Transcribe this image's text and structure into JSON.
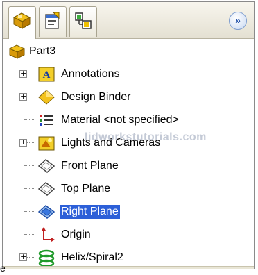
{
  "panel": {
    "tabs": [
      {
        "name": "feature-manager",
        "icon": "part-icon"
      },
      {
        "name": "property-manager",
        "icon": "property-icon"
      },
      {
        "name": "configuration-manager",
        "icon": "configuration-icon"
      }
    ],
    "expand_label": "»"
  },
  "tree": {
    "root": {
      "label": "Part3",
      "icon": "part-icon"
    },
    "items": [
      {
        "label": "Annotations",
        "icon": "annotations-icon",
        "expandable": true
      },
      {
        "label": "Design Binder",
        "icon": "design-binder-icon",
        "expandable": true
      },
      {
        "label": "Material <not specified>",
        "icon": "material-icon",
        "expandable": false
      },
      {
        "label": "Lights and Cameras",
        "icon": "lights-cameras-icon",
        "expandable": true
      },
      {
        "label": "Front Plane",
        "icon": "plane-icon",
        "expandable": false
      },
      {
        "label": "Top Plane",
        "icon": "plane-icon",
        "expandable": false
      },
      {
        "label": "Right Plane",
        "icon": "plane-icon",
        "expandable": false,
        "selected": true
      },
      {
        "label": "Origin",
        "icon": "origin-icon",
        "expandable": false
      },
      {
        "label": "Helix/Spiral2",
        "icon": "helix-icon",
        "expandable": true
      }
    ]
  },
  "watermark": "lidworkstutorials.com",
  "edge_fragment": "e",
  "colors": {
    "selection": "#2c5fd8",
    "tab_bg": "#ece9dc",
    "accent_yellow": "#f0c000"
  }
}
